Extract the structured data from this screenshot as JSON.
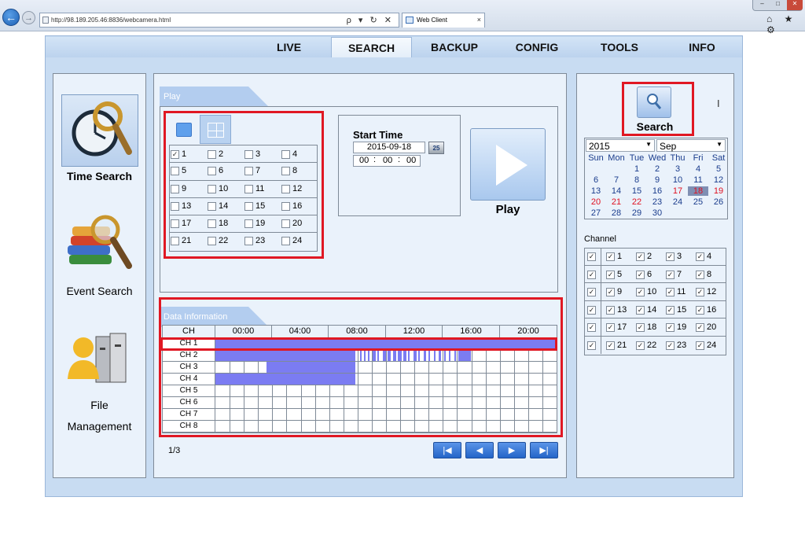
{
  "browser": {
    "url": "http://98.189.205.46:8836/webcamera.html",
    "tab_title": "Web Client",
    "tab_close": "×",
    "address_tools": "ρ ▾ ↻ ✕",
    "right_icons": "⌂ ★ ⚙",
    "window_buttons": [
      "–",
      "□",
      "✕"
    ]
  },
  "nav": {
    "tabs": [
      "LIVE",
      "SEARCH",
      "BACKUP",
      "CONFIG",
      "TOOLS",
      "INFO"
    ],
    "active": "SEARCH"
  },
  "left": {
    "time_search": "Time Search",
    "event_search": "Event Search",
    "file_management_1": "File",
    "file_management_2": "Management"
  },
  "play": {
    "header": "Play",
    "channels": [
      "1",
      "2",
      "3",
      "4",
      "5",
      "6",
      "7",
      "8",
      "9",
      "10",
      "11",
      "12",
      "13",
      "14",
      "15",
      "16",
      "17",
      "18",
      "19",
      "20",
      "21",
      "22",
      "23",
      "24"
    ],
    "checked": [
      "1"
    ],
    "start_time_label": "Start Time",
    "date": "2015-09-18",
    "cal_icon": "25",
    "hh": "00",
    "mm": "00",
    "ss": "00",
    "play_label": "Play"
  },
  "data_info": {
    "header": "Data Information",
    "ch_header": "CH",
    "times": [
      "00:00",
      "04:00",
      "08:00",
      "12:00",
      "16:00",
      "20:00"
    ],
    "rows": [
      "CH 1",
      "CH 2",
      "CH 3",
      "CH 4",
      "CH 5",
      "CH 6",
      "CH 7",
      "CH 8"
    ],
    "page": "1/3",
    "pager": [
      "|◀",
      "◀",
      "▶",
      "▶|"
    ]
  },
  "right": {
    "search_label": "Search",
    "year": "2015",
    "month": "Sep",
    "weekdays": [
      "Sun",
      "Mon",
      "Tue",
      "Wed",
      "Thu",
      "Fri",
      "Sat"
    ],
    "weeks": [
      [
        "",
        "",
        "1",
        "2",
        "3",
        "4",
        "5"
      ],
      [
        "6",
        "7",
        "8",
        "9",
        "10",
        "11",
        "12"
      ],
      [
        "13",
        "14",
        "15",
        "16",
        "17",
        "18",
        "19"
      ],
      [
        "20",
        "21",
        "22",
        "23",
        "24",
        "25",
        "26"
      ],
      [
        "27",
        "28",
        "29",
        "30",
        "",
        "",
        ""
      ]
    ],
    "red_days": [
      "17",
      "19",
      "20",
      "21",
      "22"
    ],
    "selected_day": "18",
    "channel_label": "Channel",
    "channels": [
      "1",
      "2",
      "3",
      "4",
      "5",
      "6",
      "7",
      "8",
      "9",
      "10",
      "11",
      "12",
      "13",
      "14",
      "15",
      "16",
      "17",
      "18",
      "19",
      "20",
      "21",
      "22",
      "23",
      "24"
    ]
  },
  "colors": {
    "accent_red": "#e01823",
    "record_bar": "#7b7cf2",
    "panel_bg": "#eaf2fb",
    "page_bg": "#c8dcf2"
  }
}
